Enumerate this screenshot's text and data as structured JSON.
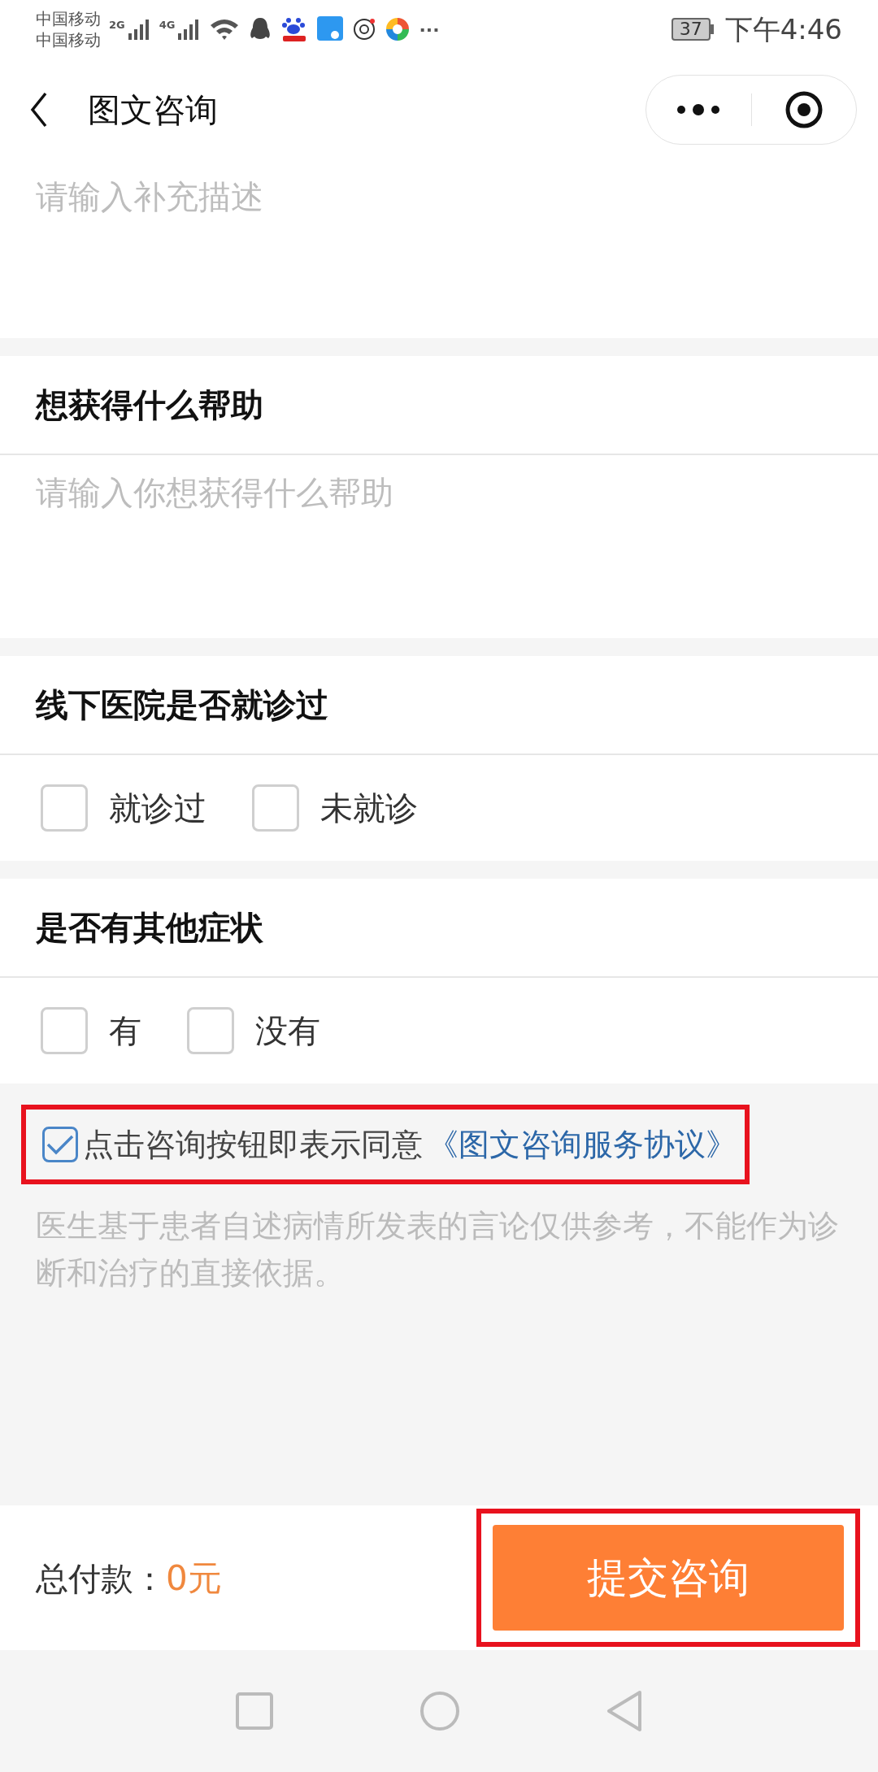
{
  "status_bar": {
    "carriers": [
      "中国移动",
      "中国移动"
    ],
    "networks": [
      "2G",
      "4G"
    ],
    "more": "···",
    "battery": "37",
    "time": "下午4:46"
  },
  "header": {
    "title": "图文咨询"
  },
  "supplement": {
    "placeholder": "请输入补充描述"
  },
  "sections": [
    {
      "kind": "textarea",
      "title": "想获得什么帮助",
      "placeholder": "请输入你想获得什么帮助"
    },
    {
      "kind": "choices",
      "title": "线下医院是否就诊过",
      "options": [
        {
          "label": "就诊过",
          "checked": false
        },
        {
          "label": "未就诊",
          "checked": false
        }
      ]
    },
    {
      "kind": "choices",
      "title": "是否有其他症状",
      "options": [
        {
          "label": "有",
          "checked": false
        },
        {
          "label": "没有",
          "checked": false
        }
      ]
    }
  ],
  "agreement": {
    "checked": true,
    "highlighted": true,
    "text": "点击咨询按钮即表示同意",
    "link": "《图文咨询服务协议》"
  },
  "disclaimer": "医生基于患者自述病情所发表的言论仅供参考，不能作为诊断和治疗的直接依据。",
  "footer": {
    "total_label": "总付款：",
    "amount": "0元",
    "submit": {
      "label": "提交咨询",
      "highlighted": true
    }
  }
}
